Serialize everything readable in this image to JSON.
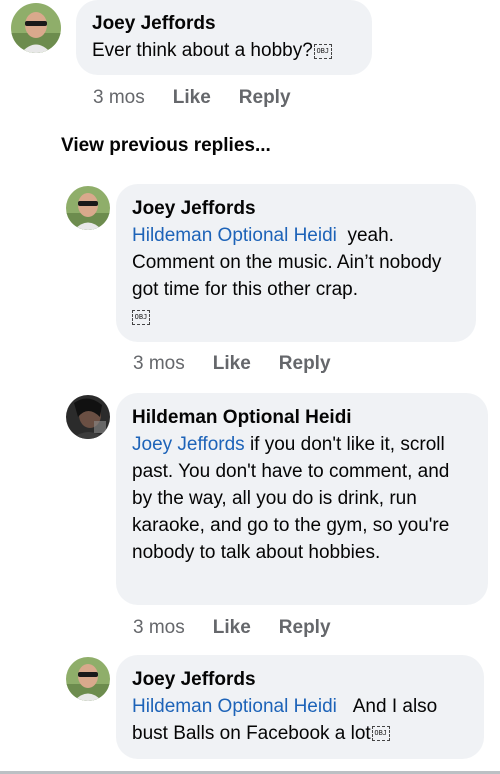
{
  "colors": {
    "bubble_bg": "#f0f2f5",
    "mention": "#1d63b8",
    "meta_text": "#65676b"
  },
  "top_comment": {
    "author": "Joey Jeffords",
    "text": "Ever think about a hobby?",
    "attachment_label": "OBJ",
    "time": "3 mos",
    "like_label": "Like",
    "reply_label": "Reply"
  },
  "view_previous_label": "View previous replies...",
  "replies": [
    {
      "author": "Joey Jeffords",
      "mention": "Hildeman Optional Heidi",
      "text": "yeah. Comment on the music. Ain’t nobody got time for this other crap.",
      "attachment_label": "OBJ",
      "time": "3 mos",
      "like_label": "Like",
      "reply_label": "Reply"
    },
    {
      "author": "Hildeman Optional Heidi",
      "mention": "Joey Jeffords",
      "text": "if you don't like it, scroll past. You don't have to comment, and by the way, all you do is drink, run karaoke, and go to the gym, so you're nobody to talk about hobbies.",
      "time": "3 mos",
      "like_label": "Like",
      "reply_label": "Reply"
    },
    {
      "author": "Joey Jeffords",
      "mention": "Hildeman Optional Heidi",
      "text": "And I also bust Balls on Facebook a lot",
      "attachment_label": "OBJ"
    }
  ]
}
